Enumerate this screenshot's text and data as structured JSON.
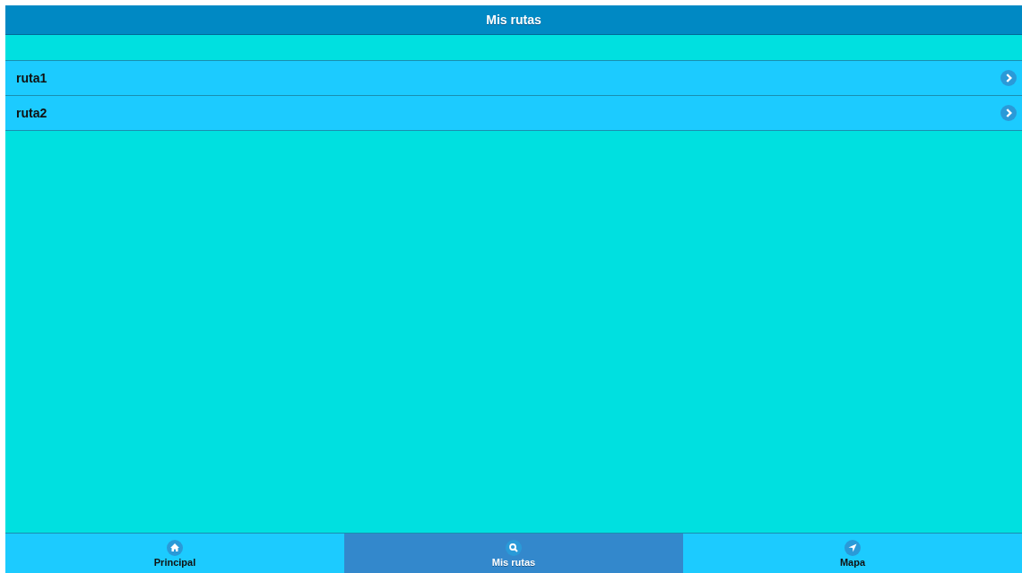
{
  "header": {
    "title": "Mis rutas"
  },
  "routes": [
    {
      "label": "ruta1"
    },
    {
      "label": "ruta2"
    }
  ],
  "tabs": [
    {
      "label": "Principal",
      "kind": "home",
      "selected": false
    },
    {
      "label": "Mis rutas",
      "kind": "search",
      "selected": true
    },
    {
      "label": "Mapa",
      "kind": "navigate",
      "selected": false
    }
  ]
}
